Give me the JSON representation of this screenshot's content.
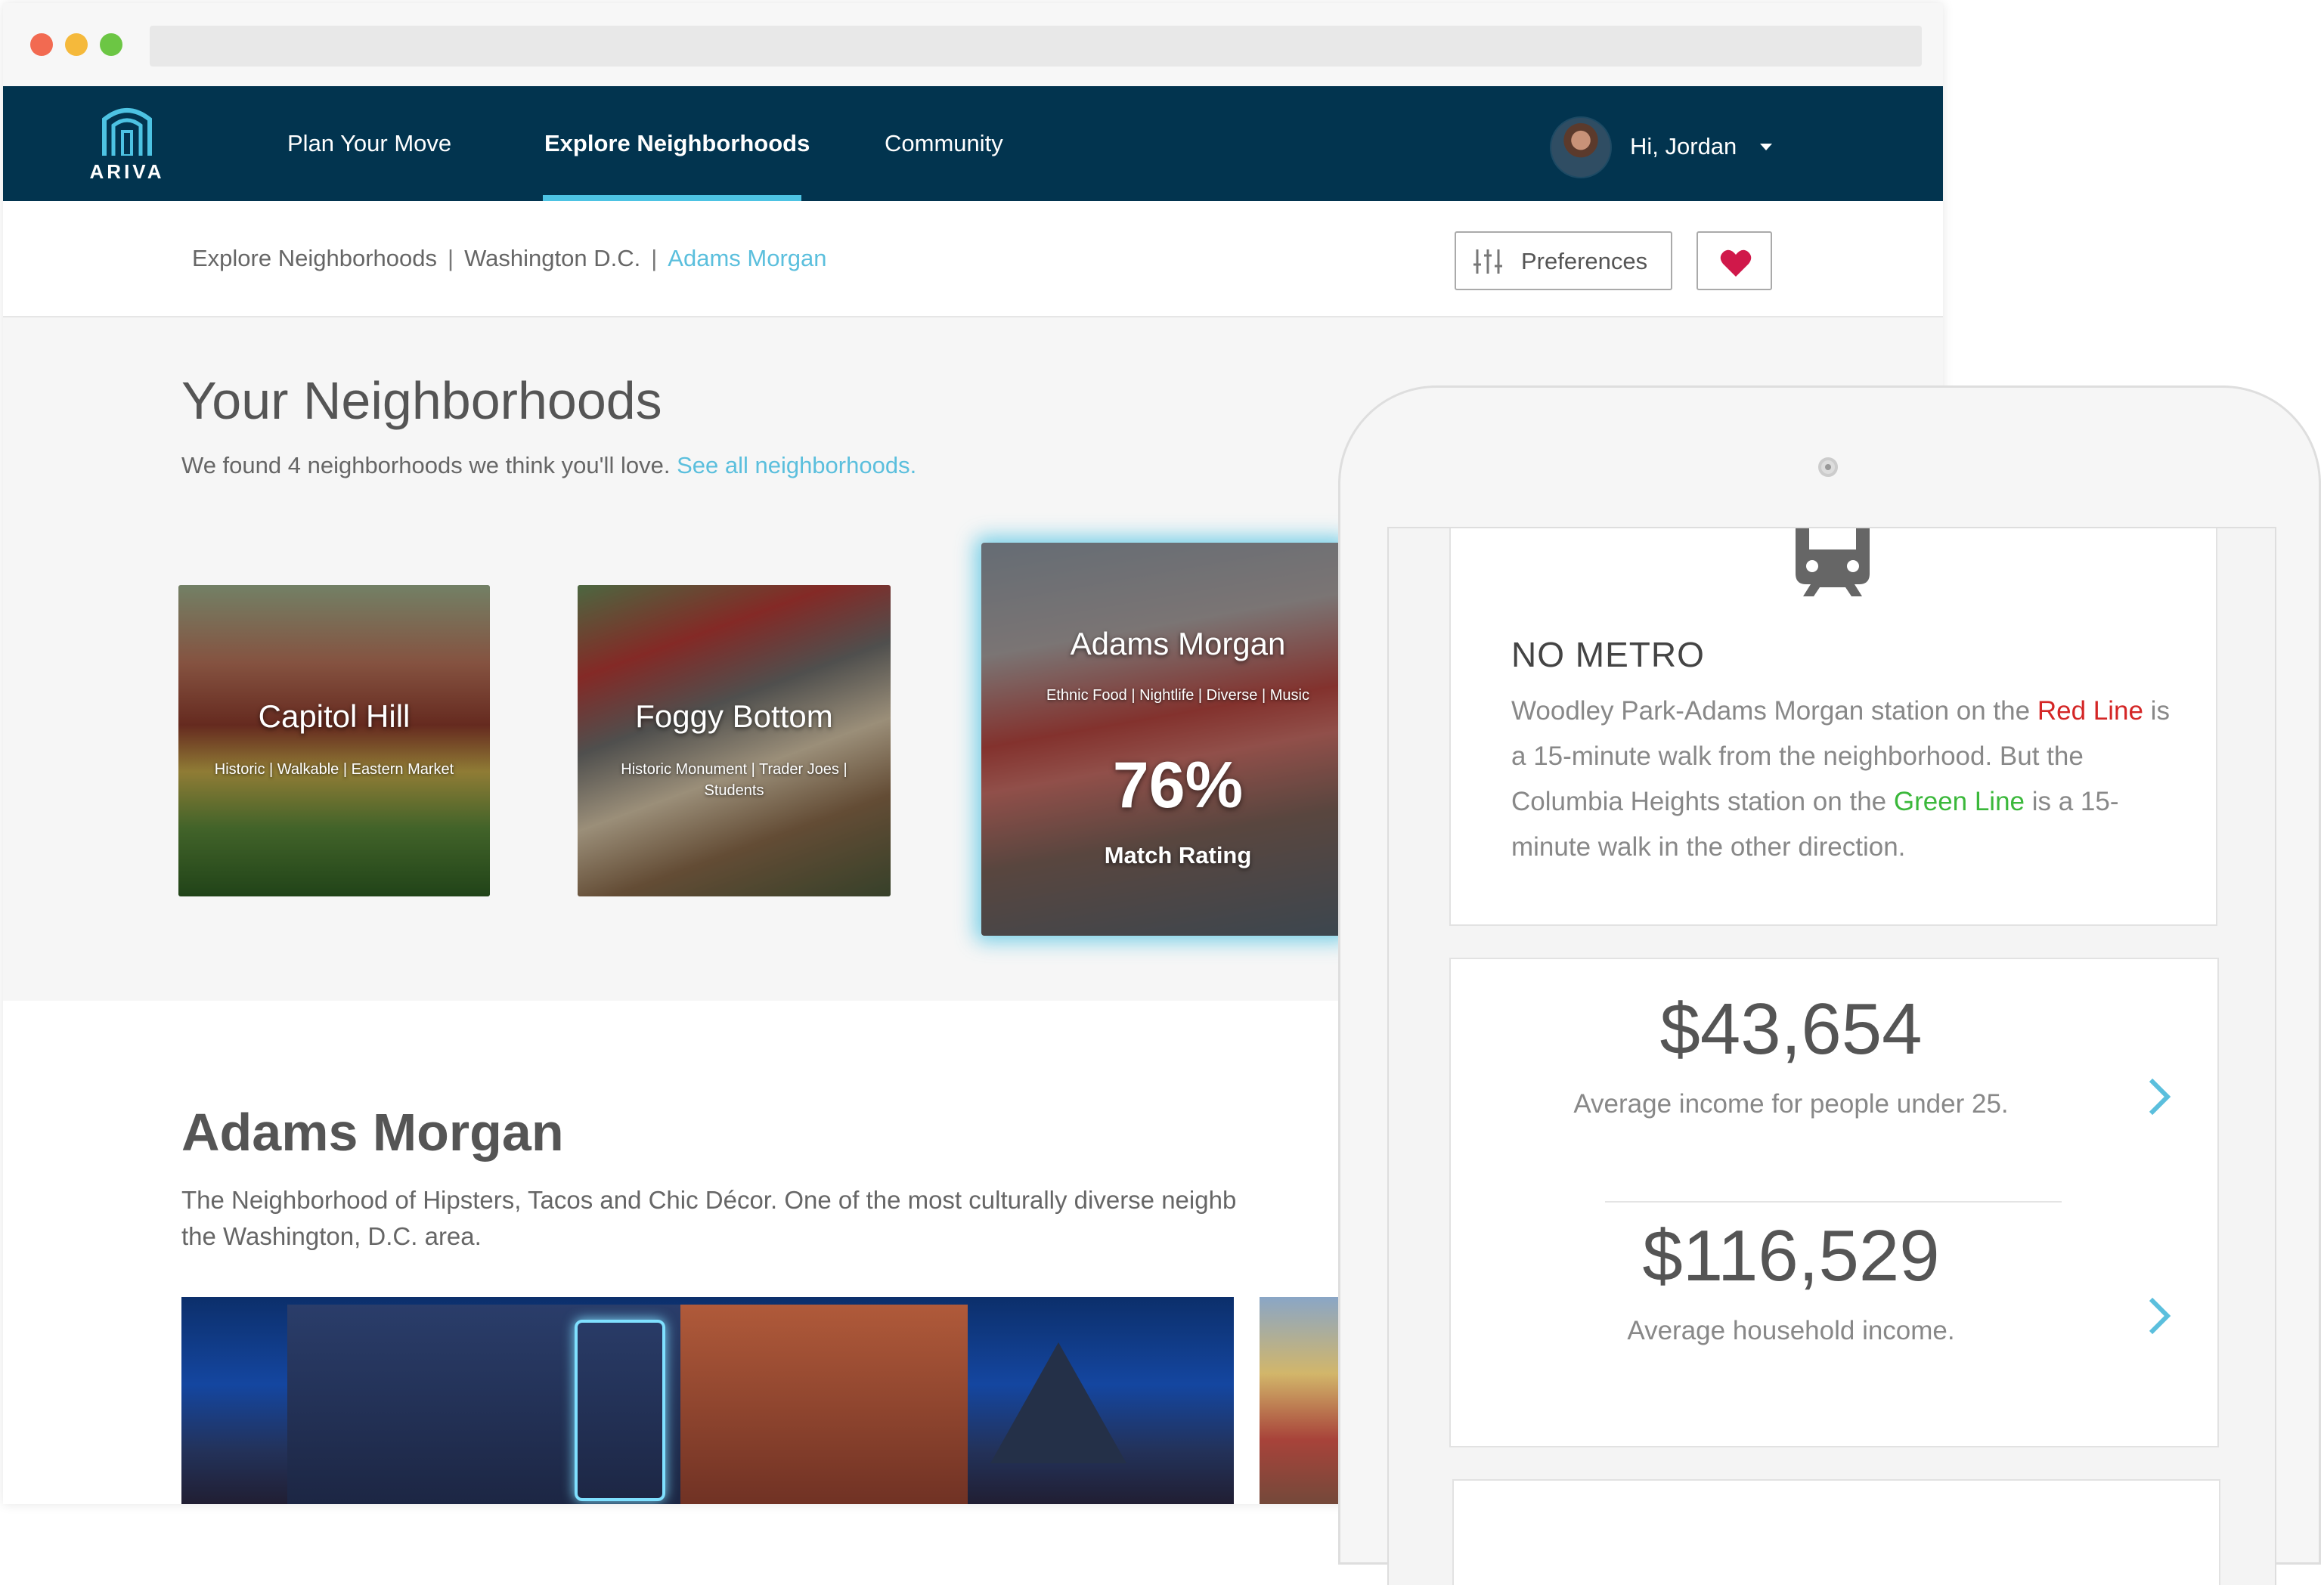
{
  "app": {
    "logo_text": "ARIVA",
    "accent": "#4dc3e3",
    "nav_bg": "#02344f"
  },
  "nav": {
    "links": [
      {
        "label": "Plan Your Move",
        "active": false
      },
      {
        "label": "Explore Neighborhoods",
        "active": true
      },
      {
        "label": "Community",
        "active": false
      }
    ],
    "user": {
      "greeting": "Hi, Jordan",
      "avatar_icon": "user-avatar"
    }
  },
  "breadcrumb": {
    "items": [
      "Explore Neighborhoods",
      "Washington D.C.",
      "Adams Morgan"
    ],
    "separator": "|"
  },
  "toolbar": {
    "preferences_label": "Preferences",
    "preferences_icon": "sliders-icon",
    "favorite_icon": "heart-icon",
    "favorite_color": "#d0184a"
  },
  "neighborhoods": {
    "title": "Your Neighborhoods",
    "subtitle": "We found 4 neighborhoods we think you'll love.",
    "see_all_link": "See all neighborhoods.",
    "cards": [
      {
        "name": "Capitol Hill",
        "tags": "Historic  | Walkable | Eastern Market"
      },
      {
        "name": "Foggy Bottom",
        "tags": "Historic Monument  | Trader Joes | Students"
      },
      {
        "name": "Adams Morgan",
        "tags": "Ethnic Food  | Nightlife | Diverse | Music",
        "match_value": "76%",
        "match_label": "Match Rating",
        "selected": true
      }
    ]
  },
  "detail": {
    "title": "Adams Morgan",
    "description": "The Neighborhood of Hipsters, Tacos and Chic Décor. One of the most culturally diverse neighb\nthe Washington, D.C. area."
  },
  "tablet": {
    "metro": {
      "icon": "train-icon",
      "title": "NO METRO",
      "text_1": "Woodley Park-Adams Morgan station on the ",
      "red_line": "Red Line",
      "text_2": " is a 15-minute walk from the neighborhood. But the Columbia Heights station on the ",
      "green_line": "Green Line",
      "text_3": " is a 15-minute walk in the other direction.",
      "red_color": "#d42626",
      "green_color": "#3bb83b"
    },
    "income": [
      {
        "value": "$43,654",
        "label": "Average income for people under 25."
      },
      {
        "value": "$116,529",
        "label": "Average household income."
      }
    ]
  }
}
